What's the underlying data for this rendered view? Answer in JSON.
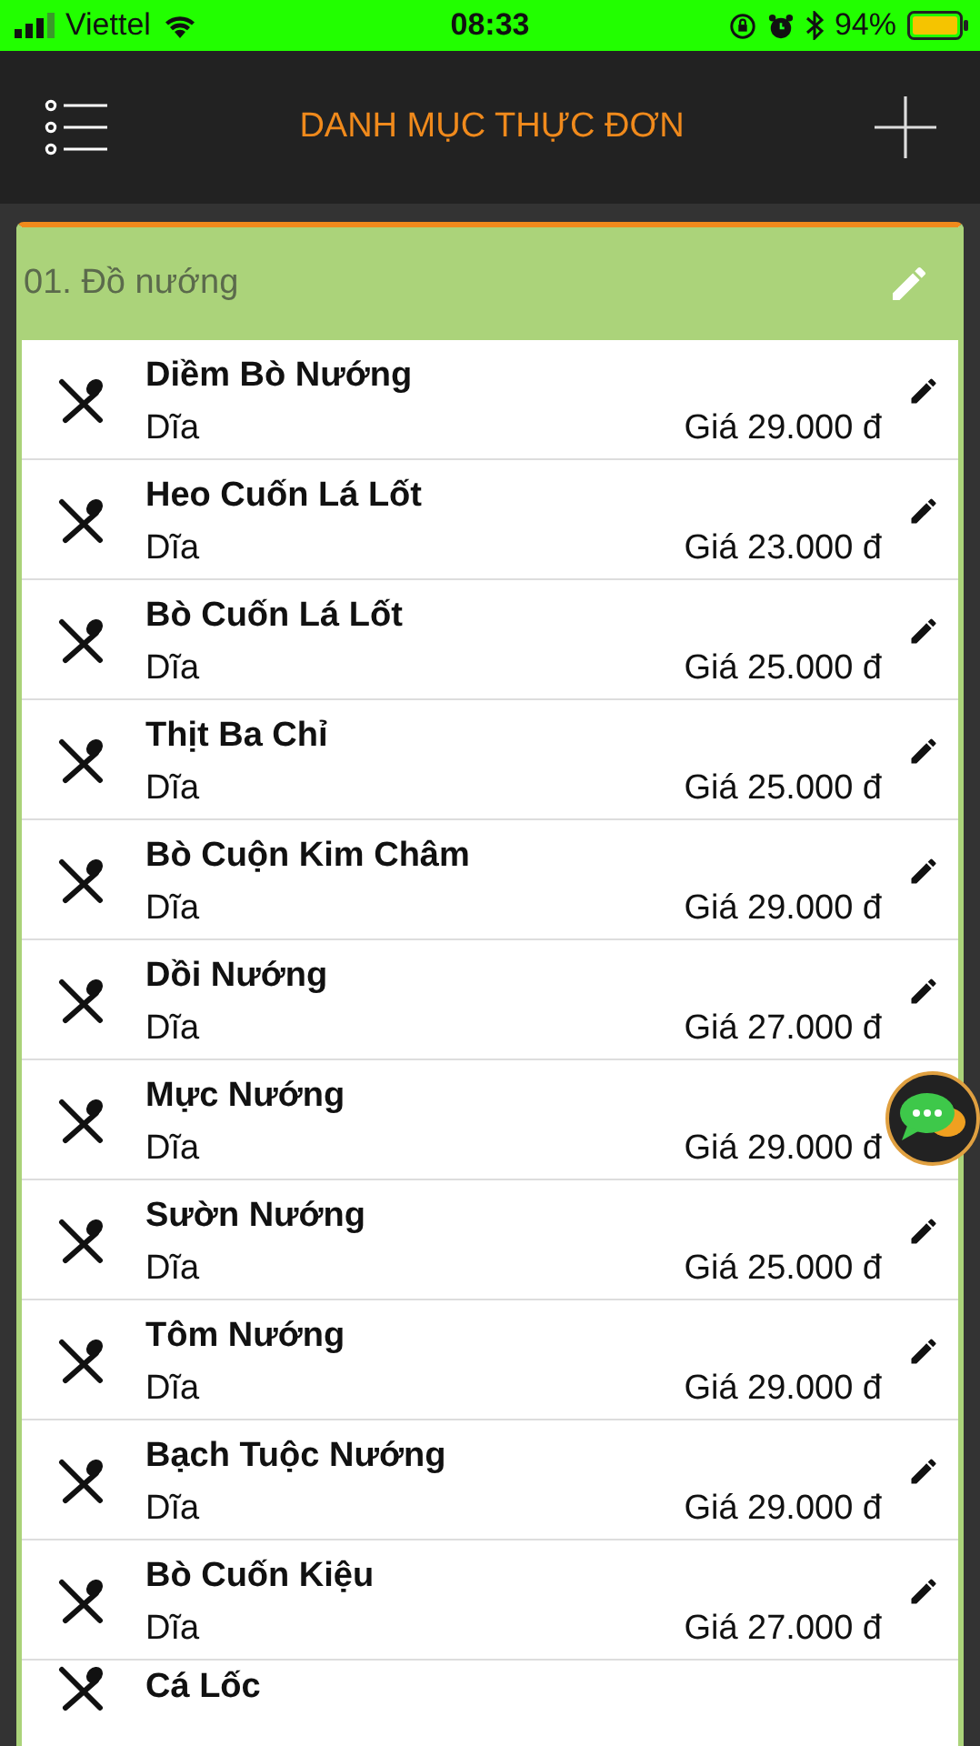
{
  "status_bar": {
    "carrier": "Viettel",
    "time": "08:33",
    "battery": "94%"
  },
  "header": {
    "title": "DANH MỤC THỰC ĐƠN"
  },
  "category": {
    "title": "01. Đồ nướng"
  },
  "items": [
    {
      "name": "Diềm Bò Nướng",
      "unit": "Dĩa",
      "price": "Giá 29.000 đ",
      "edit_visible": true
    },
    {
      "name": "Heo Cuốn Lá Lốt",
      "unit": "Dĩa",
      "price": "Giá 23.000 đ",
      "edit_visible": true
    },
    {
      "name": "Bò Cuốn Lá Lốt",
      "unit": "Dĩa",
      "price": "Giá 25.000 đ",
      "edit_visible": true
    },
    {
      "name": "Thịt Ba Chỉ",
      "unit": "Dĩa",
      "price": "Giá 25.000 đ",
      "edit_visible": true
    },
    {
      "name": "Bò Cuộn Kim Châm",
      "unit": "Dĩa",
      "price": "Giá 29.000 đ",
      "edit_visible": true
    },
    {
      "name": "Dồi Nướng",
      "unit": "Dĩa",
      "price": "Giá 27.000 đ",
      "edit_visible": true
    },
    {
      "name": "Mực Nướng",
      "unit": "Dĩa",
      "price": "Giá 29.000 đ",
      "edit_visible": false
    },
    {
      "name": "Sườn Nướng",
      "unit": "Dĩa",
      "price": "Giá 25.000 đ",
      "edit_visible": true
    },
    {
      "name": "Tôm Nướng",
      "unit": "Dĩa",
      "price": "Giá 29.000 đ",
      "edit_visible": true
    },
    {
      "name": "Bạch Tuộc Nướng",
      "unit": "Dĩa",
      "price": "Giá 29.000 đ",
      "edit_visible": true
    },
    {
      "name": "Bò Cuốn Kiệu",
      "unit": "Dĩa",
      "price": "Giá 27.000 đ",
      "edit_visible": true
    },
    {
      "name": "Cá Lốc",
      "edit_visible": false
    }
  ]
}
